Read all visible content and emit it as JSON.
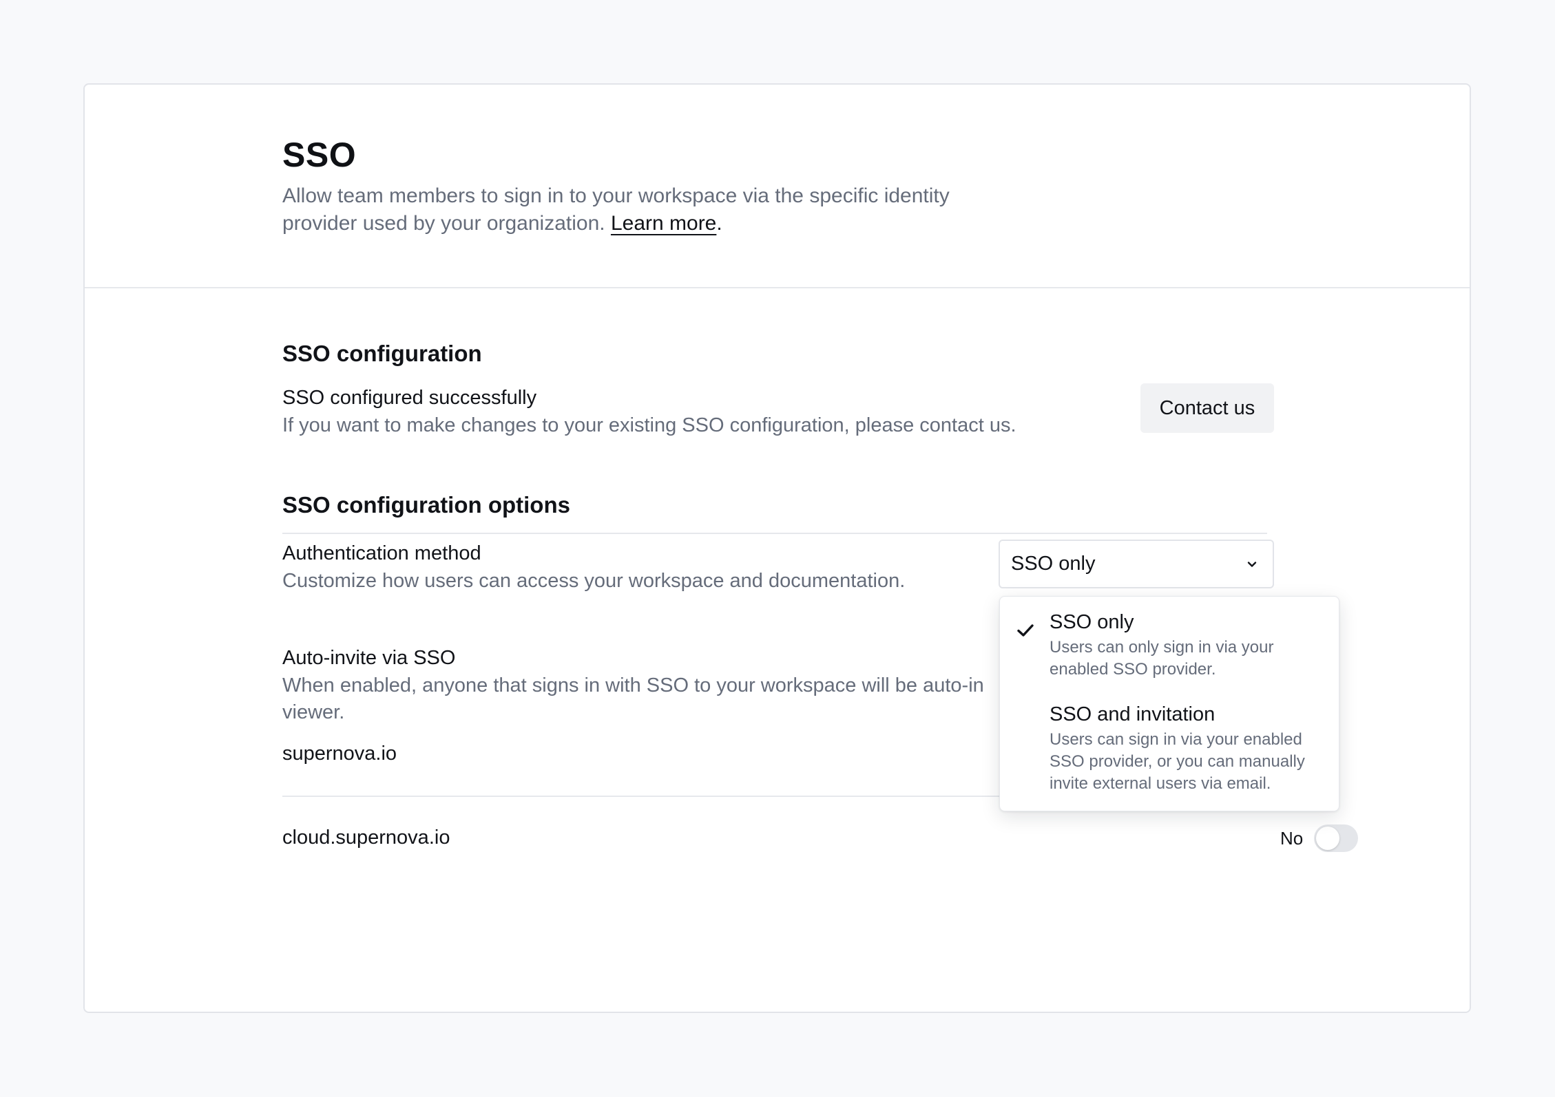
{
  "header": {
    "title": "SSO",
    "description": "Allow team members to sign in to your workspace via the specific identity provider used by your organization.",
    "learn_more": "Learn more",
    "learn_more_suffix": "."
  },
  "sso_configuration": {
    "section_title": "SSO configuration",
    "status_title": "SSO configured successfully",
    "status_desc": "If you want to make changes to your existing SSO configuration, please contact us.",
    "contact_button": "Contact us"
  },
  "sso_options": {
    "section_title": "SSO configuration options",
    "auth_method": {
      "title": "Authentication method",
      "desc": "Customize how users can access your workspace and documentation.",
      "selected": "SSO only",
      "options": [
        {
          "label": "SSO only",
          "desc": "Users can only sign in via your enabled SSO provider.",
          "checked": true
        },
        {
          "label": "SSO and invitation",
          "desc": "Users can sign in via your enabled SSO provider, or you can manually invite external users via email.",
          "checked": false
        }
      ]
    },
    "auto_invite": {
      "title": "Auto-invite via SSO",
      "desc_line1": "When enabled, anyone that signs in with SSO to your workspace will be auto-in",
      "desc_line2": "viewer.",
      "domains": [
        {
          "name": "supernova.io"
        },
        {
          "name": "cloud.supernova.io",
          "toggle_label": "No",
          "enabled": false
        }
      ]
    }
  },
  "colors": {
    "page_bg": "#f8f9fb",
    "card_bg": "#ffffff",
    "text_primary": "#111318",
    "text_secondary": "#656c7a",
    "border": "#e2e4e9",
    "button_bg": "#f1f2f4",
    "toggle_off": "#e4e6ea"
  }
}
